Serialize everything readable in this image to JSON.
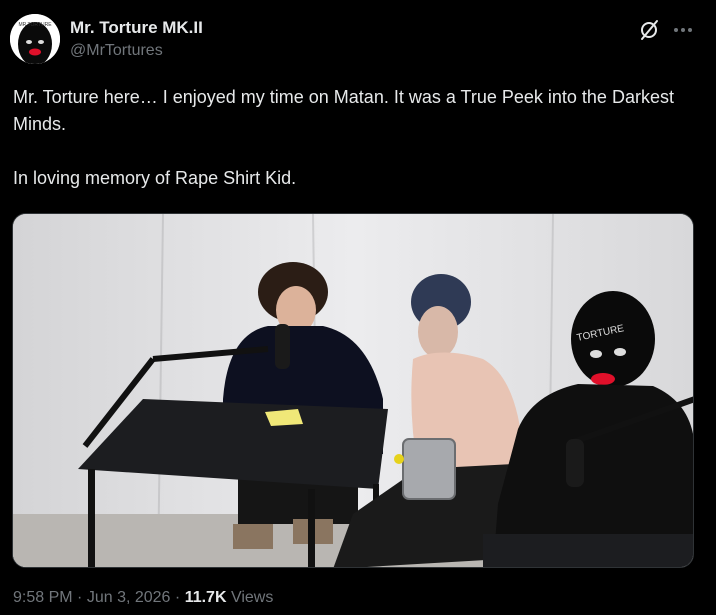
{
  "author": {
    "display_name": "Mr. Torture MK.II",
    "handle": "@MrTortures",
    "avatar_text": "MR TORTURE"
  },
  "tweet": {
    "lines": [
      "Mr. Torture here… I enjoyed my time on Matan. It was a True Peek into the Darkest Minds.",
      "In loving memory of Rape Shirt Kid."
    ]
  },
  "media": {
    "mask_text": "TORTURE"
  },
  "meta": {
    "time": "9:58 PM",
    "separator": "·",
    "date": "Jun 3, 2026",
    "views_count": "11.7K",
    "views_label": "Views"
  },
  "icons": {
    "grok": "grok-icon",
    "more": "more-icon"
  },
  "colors": {
    "background": "#000000",
    "text": "#e7e9ea",
    "secondary": "#71767b",
    "border": "#2f3336"
  }
}
